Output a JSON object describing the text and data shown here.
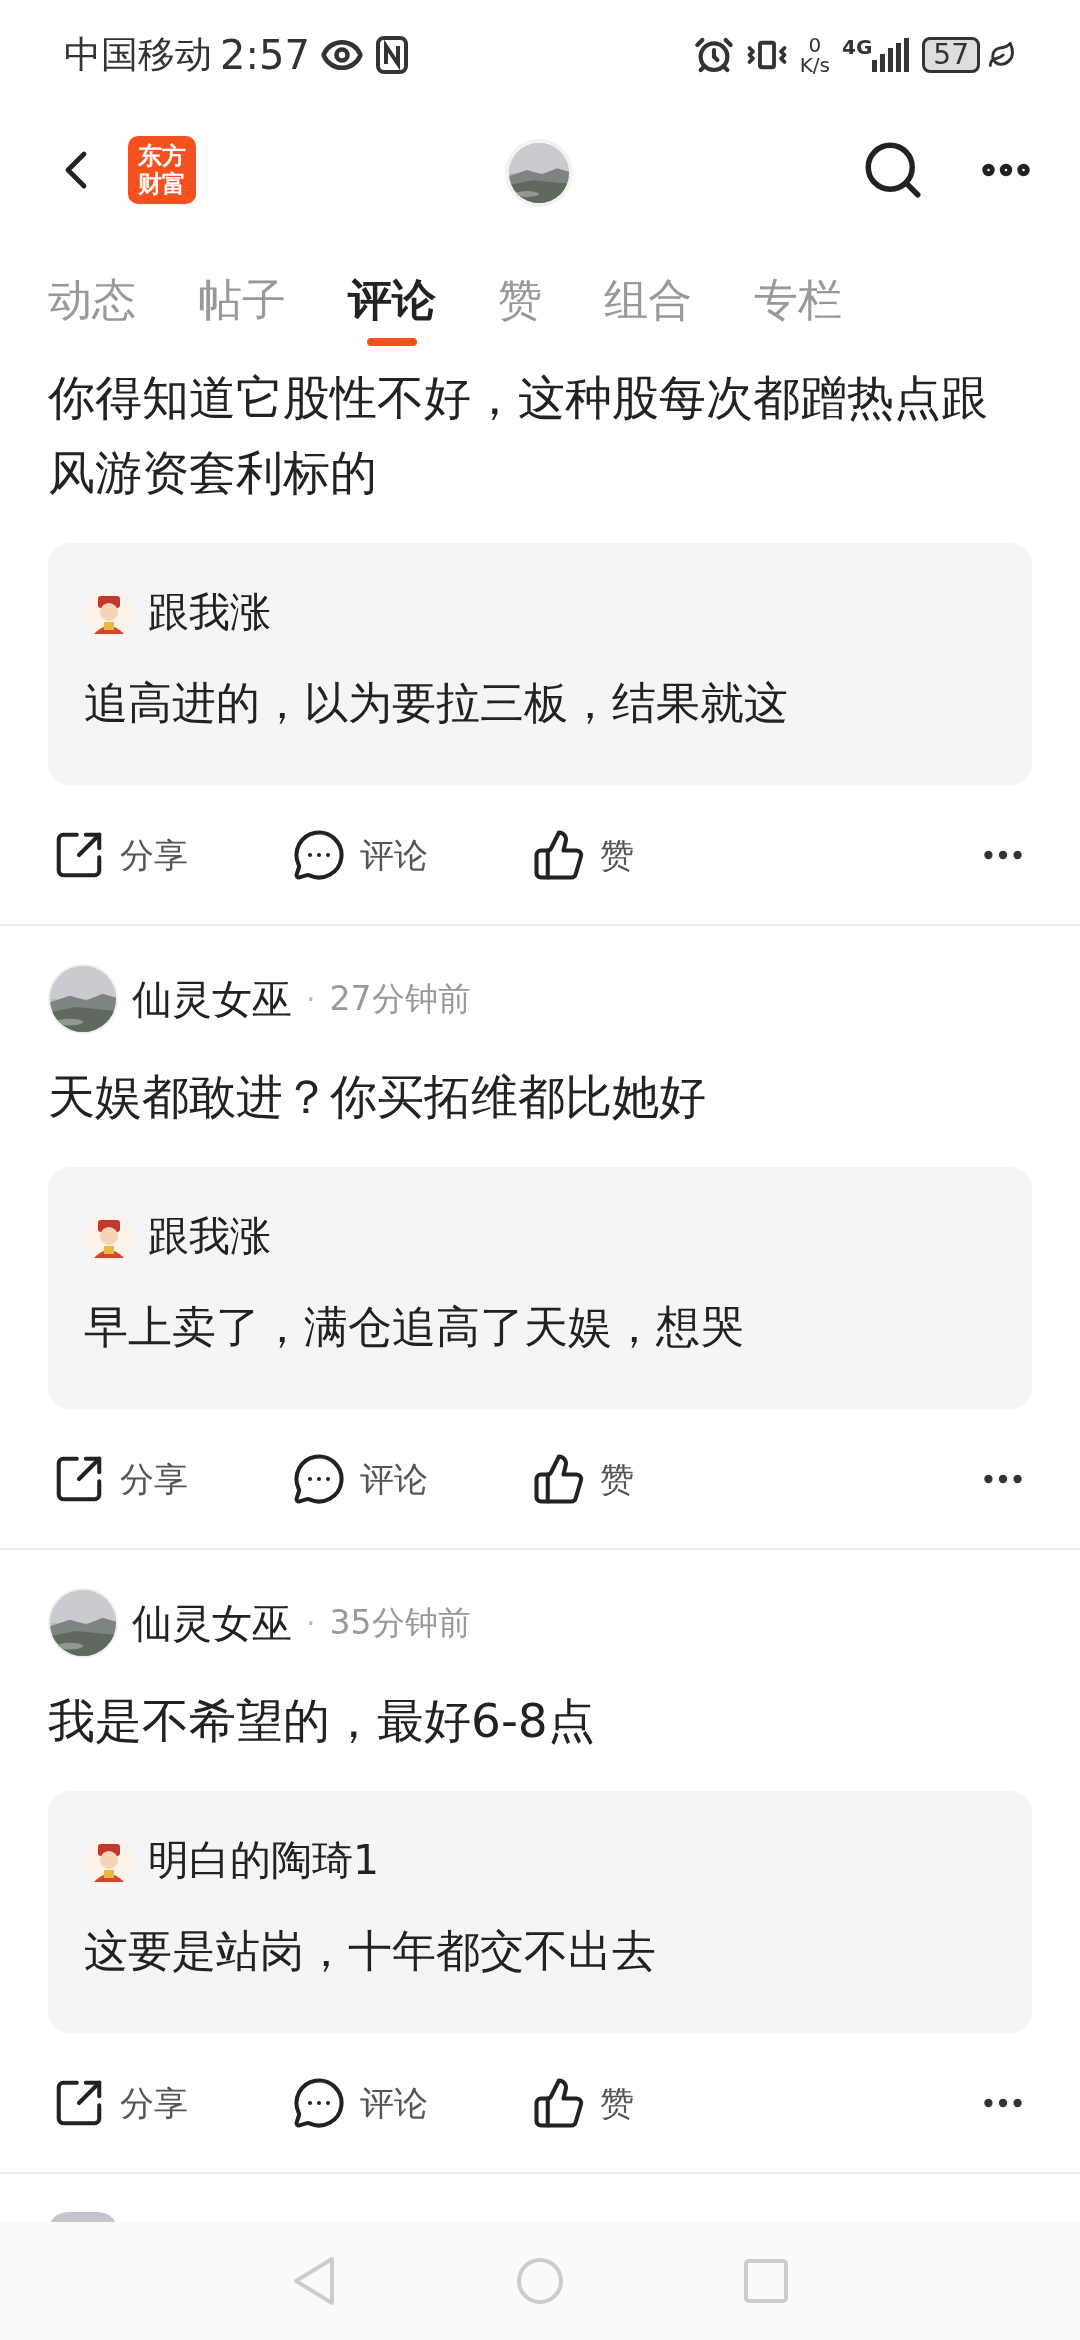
{
  "status_bar": {
    "carrier": "中国移动",
    "time": "2:57",
    "speed_value": "0",
    "speed_unit": "K/s",
    "network": "4G",
    "battery": "57"
  },
  "header": {
    "logo_lines": [
      "东方",
      "财富"
    ]
  },
  "tabs": [
    {
      "label": "动态",
      "selected": false
    },
    {
      "label": "帖子",
      "selected": false
    },
    {
      "label": "评论",
      "selected": true
    },
    {
      "label": "赞",
      "selected": false
    },
    {
      "label": "组合",
      "selected": false
    },
    {
      "label": "专栏",
      "selected": false
    }
  ],
  "comments": [
    {
      "text": "你得知道它股性不好，这种股每次都蹭热点跟风游资套利标的",
      "quote": {
        "user": "跟我涨",
        "text": "追高进的，以为要拉三板，结果就这"
      },
      "actions": [
        "分享",
        "评论",
        "赞"
      ]
    },
    {
      "author": "仙灵女巫",
      "separator": "·",
      "time": "27分钟前",
      "text": "天娱都敢进？你买拓维都比她好",
      "quote": {
        "user": "跟我涨",
        "text": "早上卖了，满仓追高了天娱，想哭"
      },
      "actions": [
        "分享",
        "评论",
        "赞"
      ]
    },
    {
      "author": "仙灵女巫",
      "separator": "·",
      "time": "35分钟前",
      "text": "我是不希望的，最好6-8点",
      "quote": {
        "user": "明白的陶琦1",
        "text": "这要是站岗，十年都交不出去"
      },
      "actions": [
        "分享",
        "评论",
        "赞"
      ]
    }
  ]
}
